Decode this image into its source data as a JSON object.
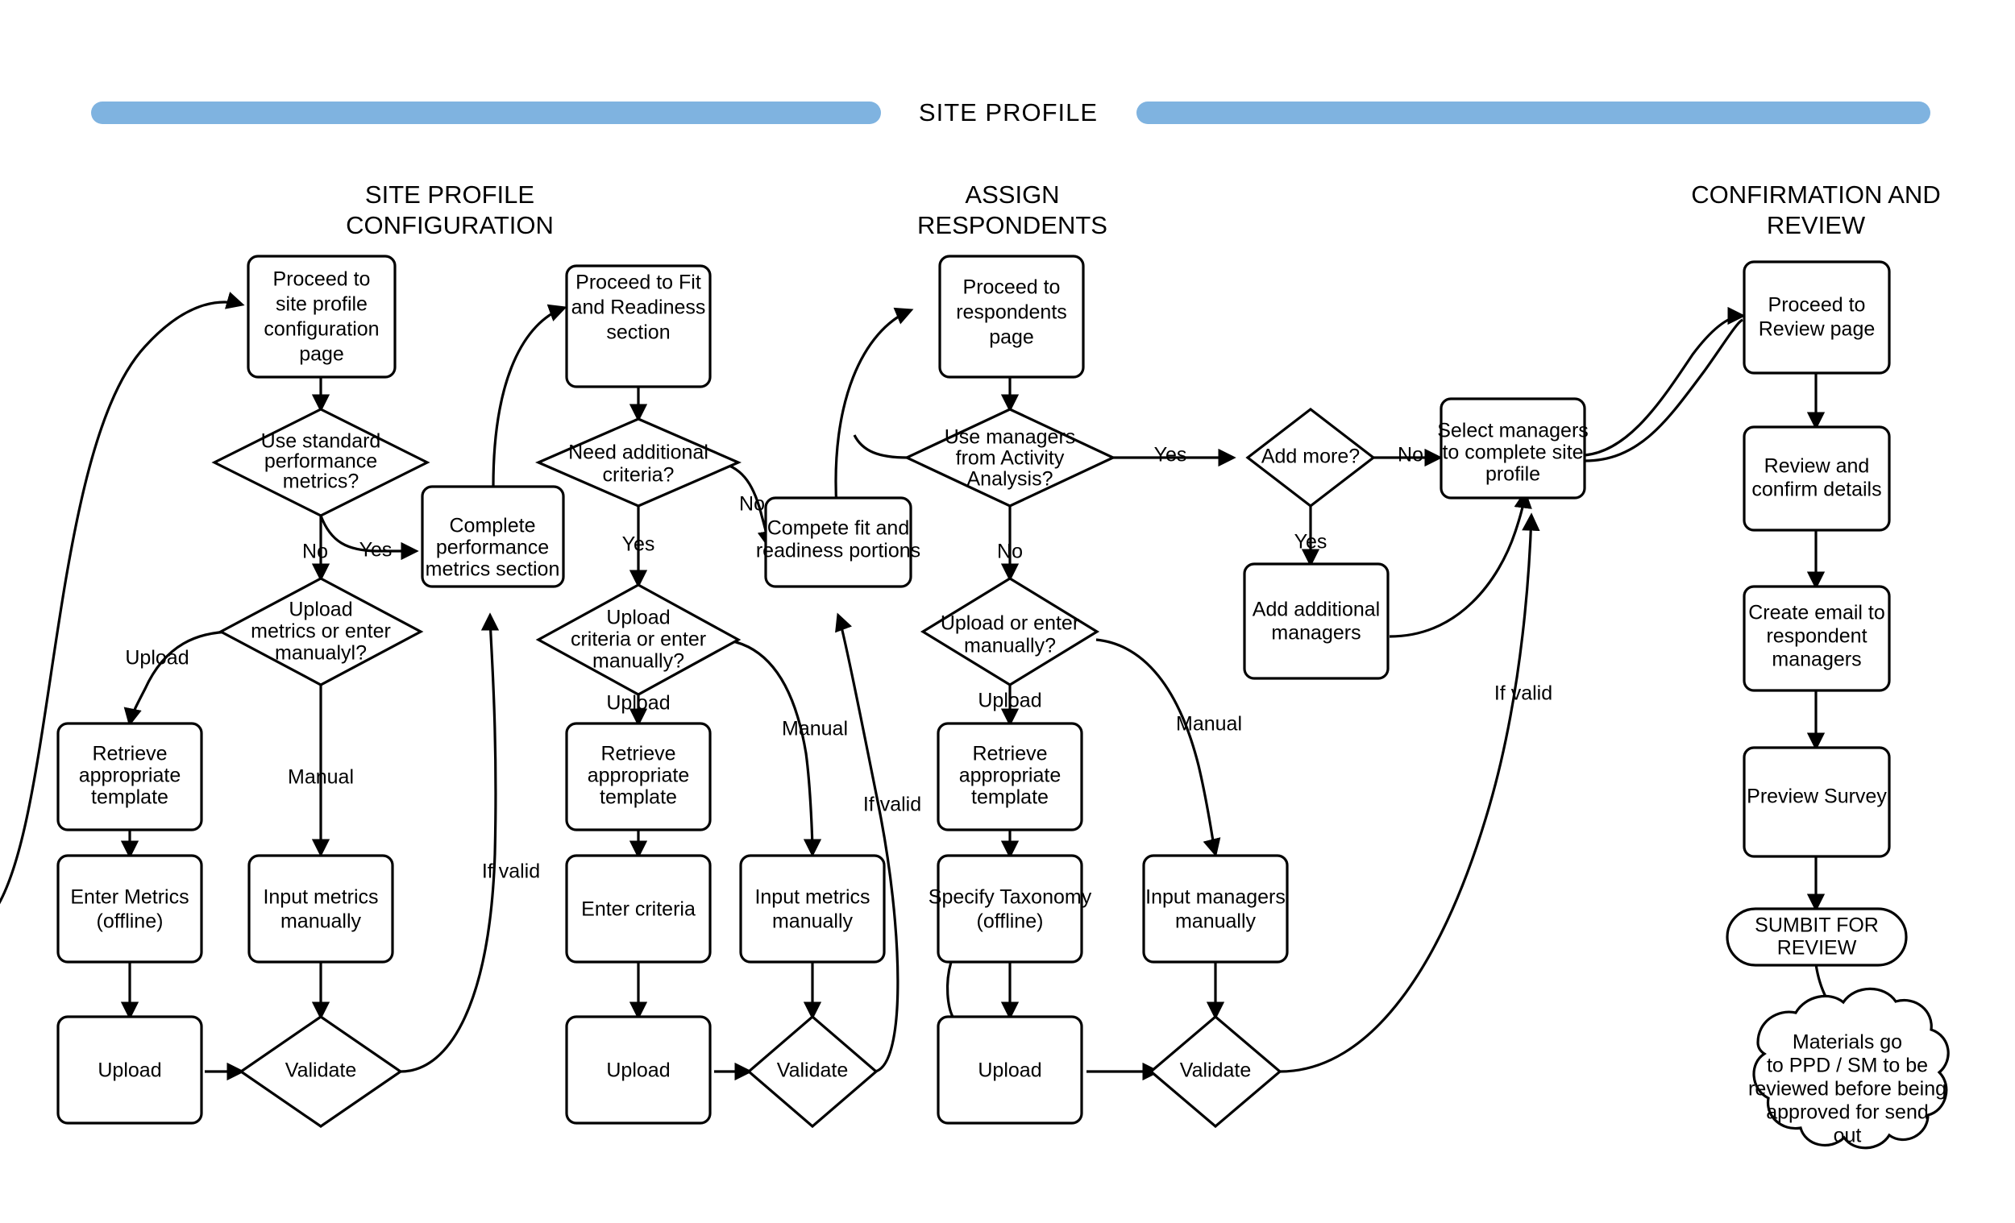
{
  "banner": {
    "title": "SITE PROFILE",
    "bar_color": "#7FB3E0"
  },
  "columns": [
    {
      "id": "site-profile-configuration",
      "title_line1": "SITE PROFILE",
      "title_line2": "CONFIGURATION"
    },
    {
      "id": "assign-respondents",
      "title_line1": "ASSIGN",
      "title_line2": "RESPONDENTS"
    },
    {
      "id": "confirmation-and-review",
      "title_line1": "CONFIRMATION AND",
      "title_line2": "REVIEW"
    }
  ],
  "nodes": {
    "proceed_site_profile": {
      "lines": [
        "Proceed to",
        "site profile",
        "configuration",
        "page"
      ],
      "shape": "process"
    },
    "use_standard_metrics": {
      "lines": [
        "Use standard",
        "performance",
        "metrics?"
      ],
      "shape": "decision"
    },
    "complete_perf_section": {
      "lines": [
        "Complete",
        "performance",
        "metrics section"
      ],
      "shape": "process"
    },
    "upload_metrics_q": {
      "lines": [
        "Upload",
        "metrics or enter",
        "manualyl?"
      ],
      "shape": "decision"
    },
    "retrieve_template_1": {
      "lines": [
        "Retrieve",
        "appropriate",
        "template"
      ],
      "shape": "process"
    },
    "enter_metrics_offline": {
      "lines": [
        "Enter Metrics",
        "(offline)"
      ],
      "shape": "process"
    },
    "upload_1": {
      "lines": [
        "Upload"
      ],
      "shape": "process"
    },
    "input_metrics_manually": {
      "lines": [
        "Input metrics",
        "manually"
      ],
      "shape": "process"
    },
    "validate_1": {
      "lines": [
        "Validate"
      ],
      "shape": "decision"
    },
    "proceed_fit_readiness": {
      "lines": [
        "Proceed to Fit",
        "and Readiness",
        "section"
      ],
      "shape": "process"
    },
    "need_additional_crit": {
      "lines": [
        "Need additional",
        "criteria?"
      ],
      "shape": "decision"
    },
    "compete_fit_readiness": {
      "lines": [
        "Compete fit and",
        "readiness portions"
      ],
      "shape": "process"
    },
    "upload_criteria_q": {
      "lines": [
        "Upload",
        "criteria or enter",
        "manually?"
      ],
      "shape": "decision"
    },
    "retrieve_template_2": {
      "lines": [
        "Retrieve",
        "appropriate",
        "template"
      ],
      "shape": "process"
    },
    "enter_criteria": {
      "lines": [
        "Enter criteria"
      ],
      "shape": "process"
    },
    "upload_2": {
      "lines": [
        "Upload"
      ],
      "shape": "process"
    },
    "input_metrics_manually2": {
      "lines": [
        "Input metrics",
        "manually"
      ],
      "shape": "process"
    },
    "validate_2": {
      "lines": [
        "Validate"
      ],
      "shape": "decision"
    },
    "proceed_respondents": {
      "lines": [
        "Proceed to",
        "respondents",
        "page"
      ],
      "shape": "process"
    },
    "use_managers_aa": {
      "lines": [
        "Use managers",
        "from Activity",
        "Analysis?"
      ],
      "shape": "decision"
    },
    "add_more": {
      "lines": [
        "Add more?"
      ],
      "shape": "decision"
    },
    "select_managers": {
      "lines": [
        "Select managers",
        "to complete site",
        "profile"
      ],
      "shape": "process"
    },
    "add_additional_mgrs": {
      "lines": [
        "Add additional",
        "managers"
      ],
      "shape": "process"
    },
    "upload_or_enter_q": {
      "lines": [
        "Upload or enter",
        "manually?"
      ],
      "shape": "decision"
    },
    "retrieve_template_3": {
      "lines": [
        "Retrieve",
        "appropriate",
        "template"
      ],
      "shape": "process"
    },
    "specify_taxonomy": {
      "lines": [
        "Specify Taxonomy",
        "(offline)"
      ],
      "shape": "process"
    },
    "upload_3": {
      "lines": [
        "Upload"
      ],
      "shape": "process"
    },
    "input_managers_manually": {
      "lines": [
        "Input managers",
        "manually"
      ],
      "shape": "process"
    },
    "validate_3": {
      "lines": [
        "Validate"
      ],
      "shape": "decision"
    },
    "proceed_review": {
      "lines": [
        "Proceed to",
        "Review page"
      ],
      "shape": "process"
    },
    "review_confirm": {
      "lines": [
        "Review and",
        "confirm details"
      ],
      "shape": "process"
    },
    "create_email": {
      "lines": [
        "Create email to",
        "respondent",
        "managers"
      ],
      "shape": "process"
    },
    "preview_survey": {
      "lines": [
        "Preview  Survey"
      ],
      "shape": "process"
    },
    "submit_for_review": {
      "lines": [
        "SUMBIT FOR",
        "REVIEW"
      ],
      "shape": "terminator"
    },
    "materials_cloud": {
      "lines": [
        "Materials go",
        "to PPD / SM to be",
        "reviewed before being",
        "approved for send",
        "out"
      ],
      "shape": "cloud"
    }
  },
  "edge_labels": {
    "no_1": "No",
    "yes_1": "Yes",
    "upload_1": "Upload",
    "manual_1": "Manual",
    "ifvalid_1": "If valid",
    "yes_2": "Yes",
    "no_2": "No",
    "upload_2": "Upload",
    "manual_2": "Manual",
    "ifvalid_2": "If valid",
    "yes_3": "Yes",
    "no_3": "No",
    "yes_3b": "Yes",
    "upload_3": "Upload",
    "manual_3": "Manual",
    "ifvalid_3": "If valid"
  }
}
